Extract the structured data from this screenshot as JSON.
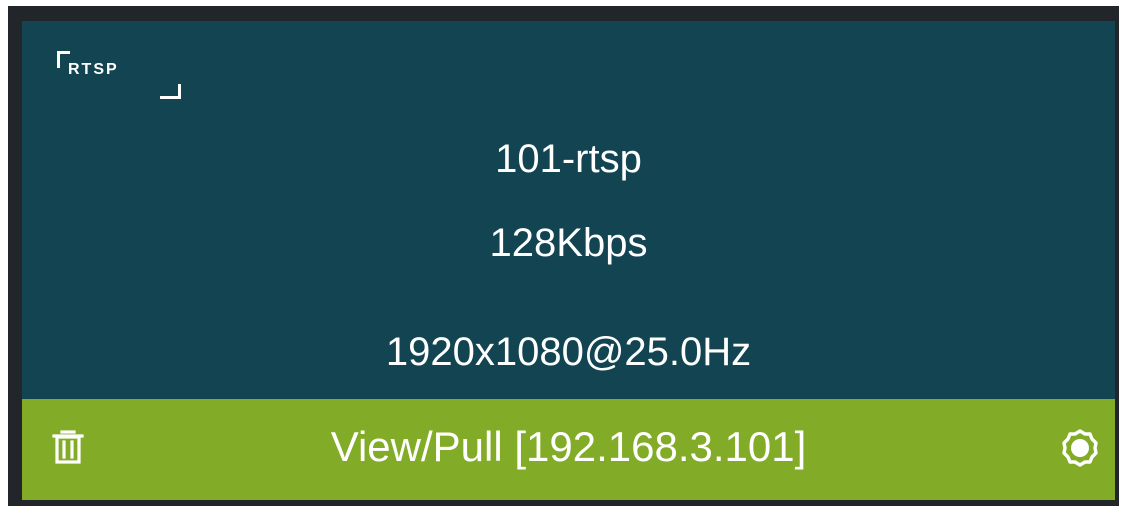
{
  "stream": {
    "badge": "RTSP",
    "name": "101-rtsp",
    "bitrate": "128Kbps",
    "resolution": "1920x1080@25.0Hz"
  },
  "footer": {
    "action_label": "View/Pull [192.168.3.101]",
    "left_icon": "trash-icon",
    "right_icon": "gear-icon"
  },
  "colors": {
    "frame": "#222529",
    "panel": "#124452",
    "footer": "#82ac28",
    "text": "#ffffff"
  }
}
